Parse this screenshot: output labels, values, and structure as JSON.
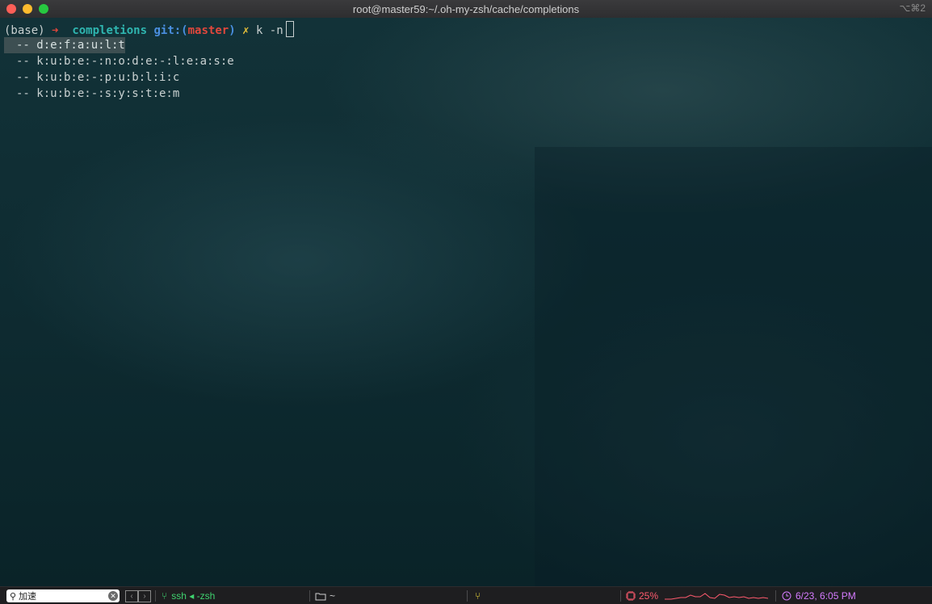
{
  "window": {
    "title": "root@master59:~/.oh-my-zsh/cache/completions",
    "shortcut": "⌥⌘2"
  },
  "terminal": {
    "prompt": {
      "env": "(base)",
      "arrow": "➜",
      "dir": "completions",
      "git_label": "git:(",
      "branch": "master",
      "git_close": ")",
      "dirty": "✗",
      "command": "k -n"
    },
    "completions": [
      "-- d:e:f:a:u:l:t",
      "-- k:u:b:e:-:n:o:d:e:-:l:e:a:s:e",
      "-- k:u:b:e:-:p:u:b:l:i:c",
      "-- k:u:b:e:-:s:y:s:t:e:m"
    ],
    "selected_index": 0
  },
  "statusbar": {
    "search_value": "加速",
    "search_icon": "search-icon",
    "job_label": "ssh ◂ -zsh",
    "folder_label": "~",
    "cpu_percent": "25%",
    "clock": "6/23, 6:05 PM"
  },
  "colors": {
    "prompt_arrow": "#e0473c",
    "prompt_dir": "#2fb6b0",
    "prompt_git": "#4a8fe0",
    "cpu": "#ff5a6e",
    "clock": "#d67bff",
    "job": "#3fd26f"
  }
}
